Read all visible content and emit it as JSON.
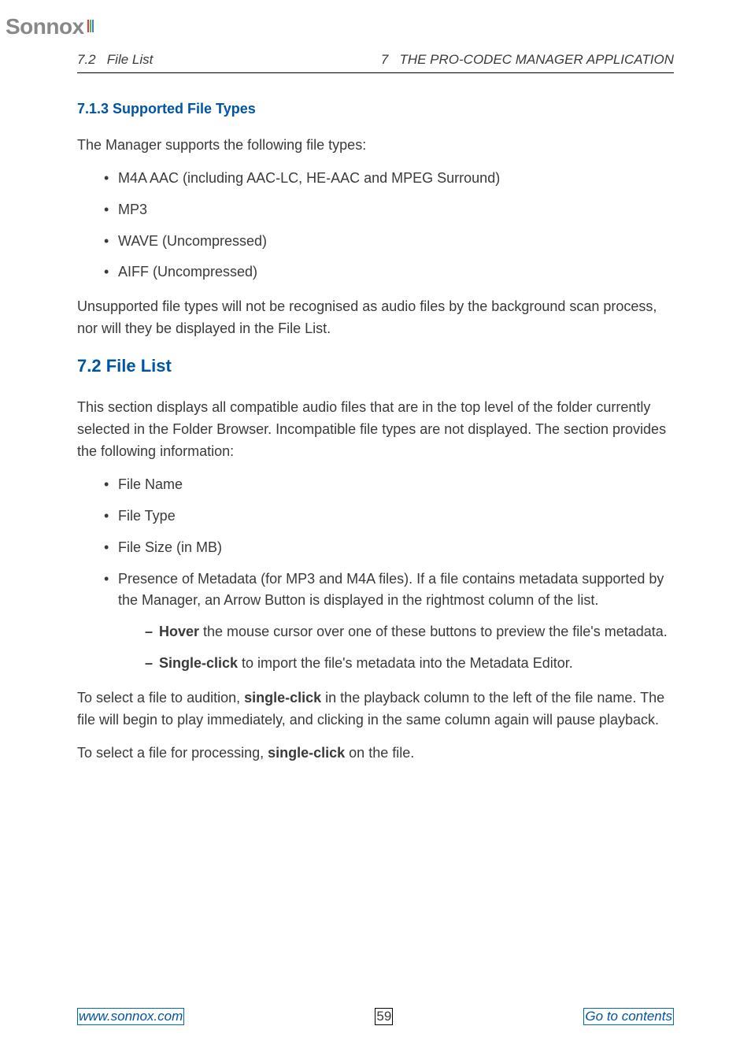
{
  "logo": "Sonnox",
  "header": {
    "left": "7.2   File List",
    "right": "7   THE PRO-CODEC MANAGER APPLICATION"
  },
  "s713": {
    "heading": "7.1.3   Supported File Types",
    "intro": "The Manager supports the following file types:",
    "items": [
      "M4A AAC (including AAC-LC, HE-AAC and MPEG Surround)",
      "MP3",
      "WAVE (Uncompressed)",
      "AIFF (Uncompressed)"
    ],
    "outro": "Unsupported file types will not be recognised as audio files by the background scan process, nor will they be displayed in the File List."
  },
  "s72": {
    "heading": "7.2   File List",
    "intro": "This section displays all compatible audio files that are in the top level of the folder currently selected in the Folder Browser.  Incompatible file types are not displayed.  The section provides the following information:",
    "items": [
      "File Name",
      "File Type",
      "File Size (in MB)"
    ],
    "meta_item": "Presence of Metadata (for MP3 and M4A files).  If a file contains metadata supported by the Manager, an Arrow Button is displayed in the rightmost column of the list.",
    "sub": {
      "hover_bold": "Hover",
      "hover_rest": " the mouse cursor over one of these buttons to preview the file's metadata.",
      "click_bold": "Single-click",
      "click_rest": " to import the file's metadata into the Metadata Editor."
    },
    "p_audition_a": "To select a file to audition, ",
    "p_audition_bold": "single-click",
    "p_audition_b": " in the playback column to the left of the file name. The file will begin to play immediately, and clicking in the same column again will pause playback.",
    "p_process_a": "To select a file for processing, ",
    "p_process_bold": "single-click",
    "p_process_b": " on the file."
  },
  "footer": {
    "url": "www.sonnox.com",
    "page": "59",
    "contents": "Go to contents"
  }
}
